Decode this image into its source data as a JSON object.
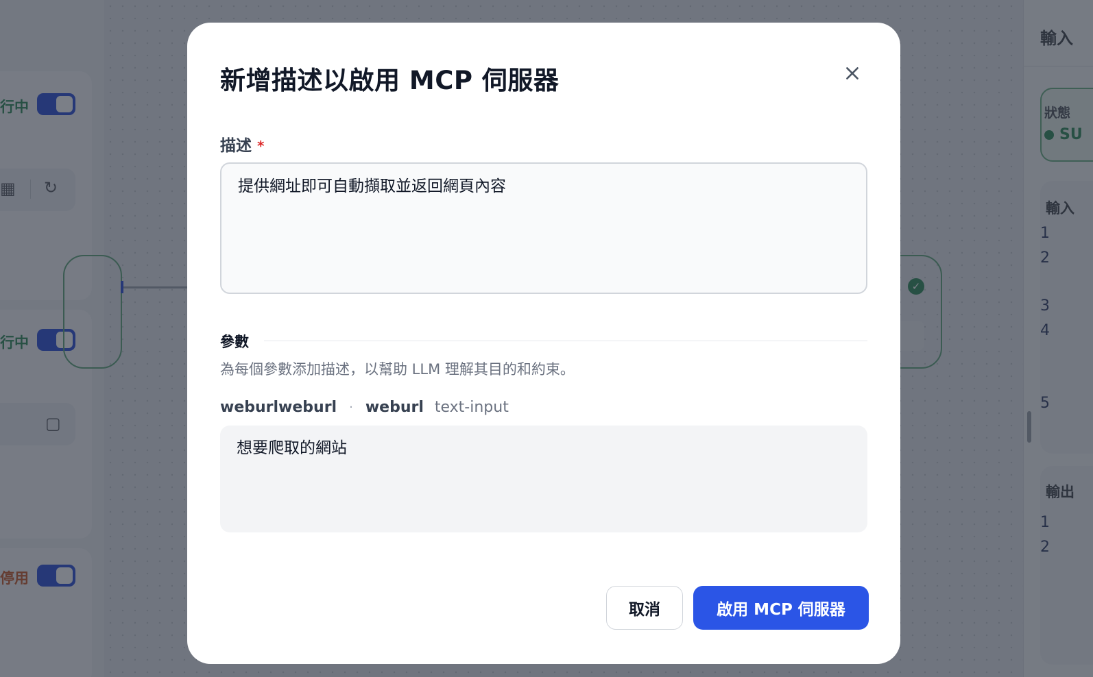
{
  "background": {
    "left_panel": {
      "status_running": "行中",
      "status_disabled": "停用"
    },
    "right_panel": {
      "title": "輸入",
      "status_label": "狀態",
      "status_value": "SU",
      "input_section_title": "輸入",
      "input_line_numbers": [
        "1",
        "2",
        "3",
        "4",
        "5"
      ],
      "output_section_title": "輸出",
      "output_line_numbers": [
        "1",
        "2"
      ]
    }
  },
  "modal": {
    "title": "新增描述以啟用 MCP 伺服器",
    "description_field": {
      "label": "描述",
      "required_mark": "*",
      "value": "提供網址即可自動擷取並返回網頁內容"
    },
    "params_section": {
      "title": "參數",
      "hint": "為每個參數添加描述，以幫助 LLM 理解其目的和約束。",
      "items": [
        {
          "name": "weburlweburl",
          "separator": "·",
          "key": "weburl",
          "type": "text-input",
          "description": "想要爬取的網站"
        }
      ]
    },
    "buttons": {
      "cancel": "取消",
      "confirm": "啟用 MCP 伺服器"
    }
  },
  "colors": {
    "primary": "#2b55e6",
    "required": "#dc2626",
    "success": "#2f8a57",
    "warning": "#c75b2b"
  }
}
